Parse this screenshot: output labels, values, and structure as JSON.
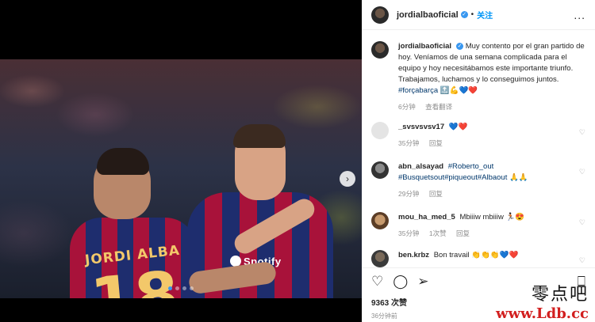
{
  "post": {
    "jersey_name": "JORDI ALBA",
    "jersey_number": "18",
    "sponsor_text": "Spotify",
    "active_slide": 1,
    "slide_count": 4
  },
  "header": {
    "username": "jordialbaoficial",
    "separator": "•",
    "follow_label": "关注",
    "more_label": "..."
  },
  "caption": {
    "username": "jordialbaoficial",
    "text": "Muy contento por el gran partido de hoy. Veníamos de una semana complicada para el equipo y hoy necesitábamos este importante triunfo. Trabajamos, luchamos y lo conseguimos juntos.",
    "hashtag": "#forçabarça",
    "emoji": "🔝💪💙❤️",
    "time": "6分钟",
    "translate": "查看翻译"
  },
  "comments": [
    {
      "username": "_svsvsvsv17",
      "text": "💙❤️",
      "time": "35分钟",
      "reply": "回复"
    },
    {
      "username": "abn_alsayad",
      "tags": "#Roberto_out #Busquetsout#piqueout#Albaout",
      "text": "🙏🙏",
      "time": "29分钟",
      "reply": "回复"
    },
    {
      "username": "mou_ha_med_5",
      "text": "Mbiiiw mbiiiw 🏃🏿😍",
      "time": "35分钟",
      "likes": "1次赞",
      "reply": "回复"
    },
    {
      "username": "ben.krbz",
      "text": "Bon travail 👏👏👏💙❤️",
      "time": "",
      "reply": ""
    }
  ],
  "actions": {
    "likes": "9363 次赞",
    "time": "36分钟前"
  },
  "watermark": {
    "line1": "零点吧",
    "line2": "www.Ldb.cc"
  },
  "colors": {
    "accent": "#0095f6",
    "verified": "#3897f0"
  }
}
